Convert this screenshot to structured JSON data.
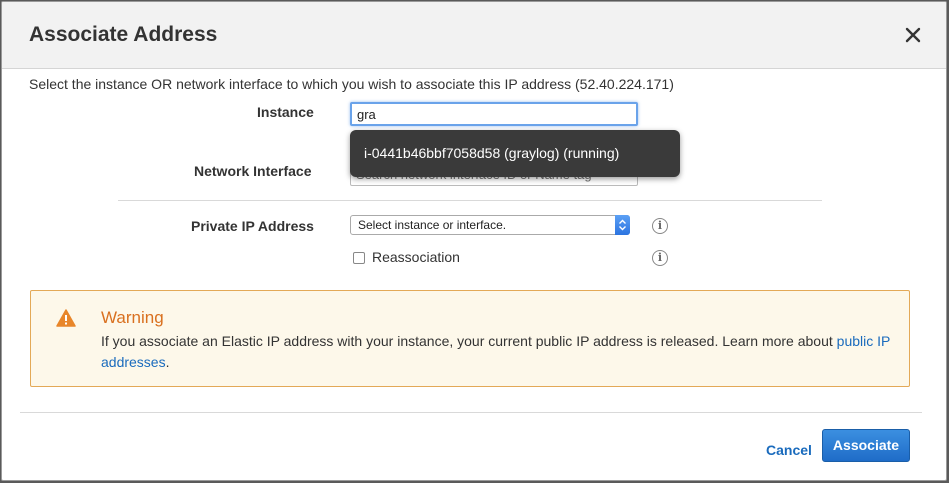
{
  "dialog": {
    "title": "Associate Address",
    "intro": "Select the instance OR network interface to which you wish to associate this IP address (52.40.224.171)"
  },
  "form": {
    "instance_label": "Instance",
    "instance_value": "gra",
    "network_interface_label": "Network Interface",
    "network_interface_placeholder": "Search network interface ID or Name tag",
    "private_ip_label": "Private IP Address",
    "private_ip_selected": "Select instance or interface.",
    "reassociation_label": "Reassociation"
  },
  "autocomplete": {
    "items": [
      "i-0441b46bbf7058d58 (graylog) (running)"
    ]
  },
  "warning": {
    "title": "Warning",
    "text": "If you associate an Elastic IP address with your instance, your current public IP address is released. Learn more about ",
    "link": "public IP addresses",
    "suffix": "."
  },
  "footer": {
    "cancel_label": "Cancel",
    "associate_label": "Associate"
  },
  "icons": {
    "close": "close-icon",
    "info": "info-icon",
    "warning": "warning-icon",
    "select_arrows": "chevron-updown-icon"
  },
  "colors": {
    "primary_button": "#1f6cc8",
    "link": "#1a6bbd",
    "warning_border": "#e3a957",
    "warning_title": "#d9701f",
    "dropdown_bg": "#3a3a3a"
  }
}
